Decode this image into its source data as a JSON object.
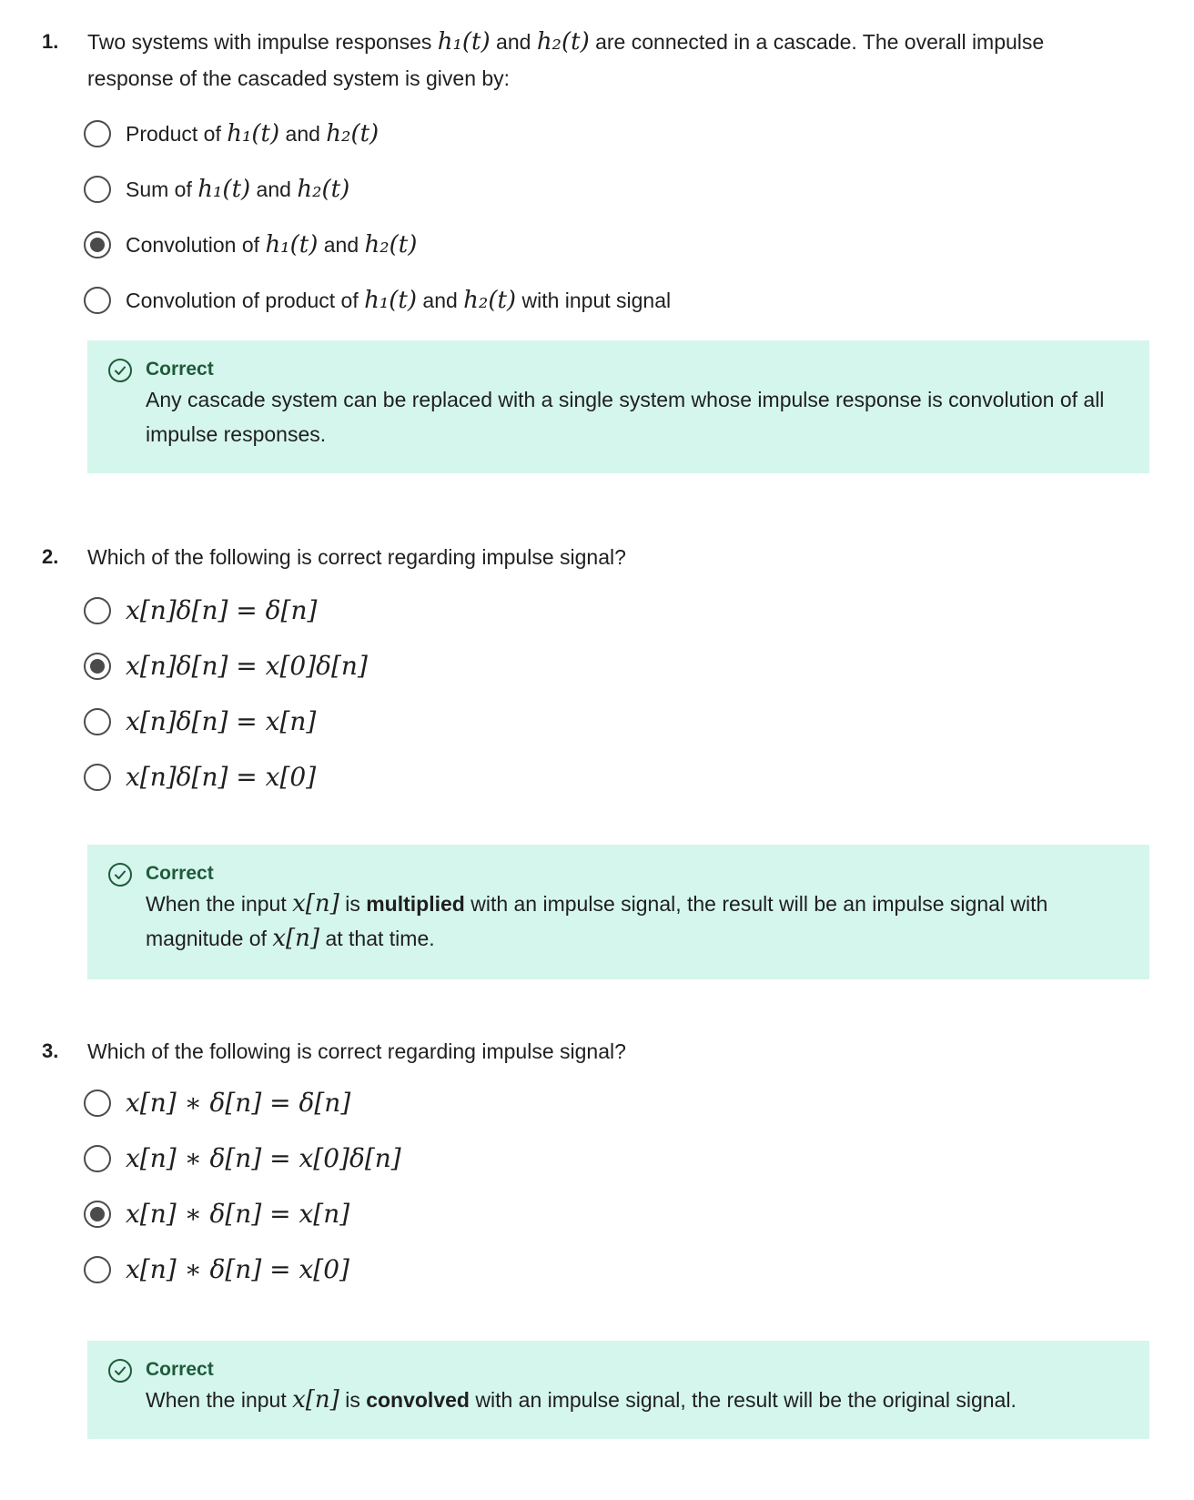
{
  "questions": [
    {
      "number": "1.",
      "text_a": "Two systems with impulse responses ",
      "math_a": "h₁(t)",
      "text_b": " and ",
      "math_b": "h₂(t)",
      "text_c": " are connected in a cascade. The overall impulse response of the cascaded system is given by:",
      "options": [
        {
          "pre": "Product of ",
          "m1": "h₁(t)",
          "mid": " and ",
          "m2": "h₂(t)",
          "post": "",
          "selected": false
        },
        {
          "pre": "Sum of ",
          "m1": "h₁(t)",
          "mid": " and ",
          "m2": "h₂(t)",
          "post": "",
          "selected": false
        },
        {
          "pre": "Convolution of ",
          "m1": "h₁(t)",
          "mid": " and ",
          "m2": "h₂(t)",
          "post": "",
          "selected": true
        },
        {
          "pre": "Convolution of product of ",
          "m1": "h₁(t)",
          "mid": " and ",
          "m2": "h₂(t)",
          "post": " with input signal",
          "selected": false
        }
      ],
      "feedback": {
        "title": "Correct",
        "text": "Any cascade system can be replaced with a single system whose impulse response is convolution of all impulse responses."
      }
    },
    {
      "number": "2.",
      "text": "Which of the following is correct regarding impulse signal?",
      "options": [
        {
          "label": "x[n]δ[n] = δ[n]",
          "selected": false
        },
        {
          "label": "x[n]δ[n] = x[0]δ[n]",
          "selected": true
        },
        {
          "label": "x[n]δ[n] = x[n]",
          "selected": false
        },
        {
          "label": "x[n]δ[n] = x[0]",
          "selected": false
        }
      ],
      "feedback": {
        "title": "Correct",
        "t1": "When the input ",
        "m1": "x[n]",
        "t2": " is ",
        "bold": "multiplied",
        "t3": " with an impulse signal, the result will be an impulse signal with magnitude of ",
        "m2": "x[n]",
        "t4": " at that time."
      }
    },
    {
      "number": "3.",
      "text": "Which of the following is correct regarding impulse signal?",
      "options": [
        {
          "label": "x[n] ∗ δ[n] = δ[n]",
          "selected": false
        },
        {
          "label": "x[n] ∗ δ[n] = x[0]δ[n]",
          "selected": false
        },
        {
          "label": "x[n] ∗ δ[n] = x[n]",
          "selected": true
        },
        {
          "label": "x[n] ∗ δ[n] = x[0]",
          "selected": false
        }
      ],
      "feedback": {
        "title": "Correct",
        "t1": "When the input ",
        "m1": "x[n]",
        "t2": " is ",
        "bold": "convolved",
        "t3": " with an impulse signal, the result will be the original signal."
      }
    }
  ],
  "icons": {
    "feedback_icon": "check-circle-icon",
    "radio_icon": "radio-icon"
  },
  "colors": {
    "feedback_bg": "#d5f6ec",
    "feedback_title": "#1f5a3c",
    "radio": "#4b4b4b"
  }
}
